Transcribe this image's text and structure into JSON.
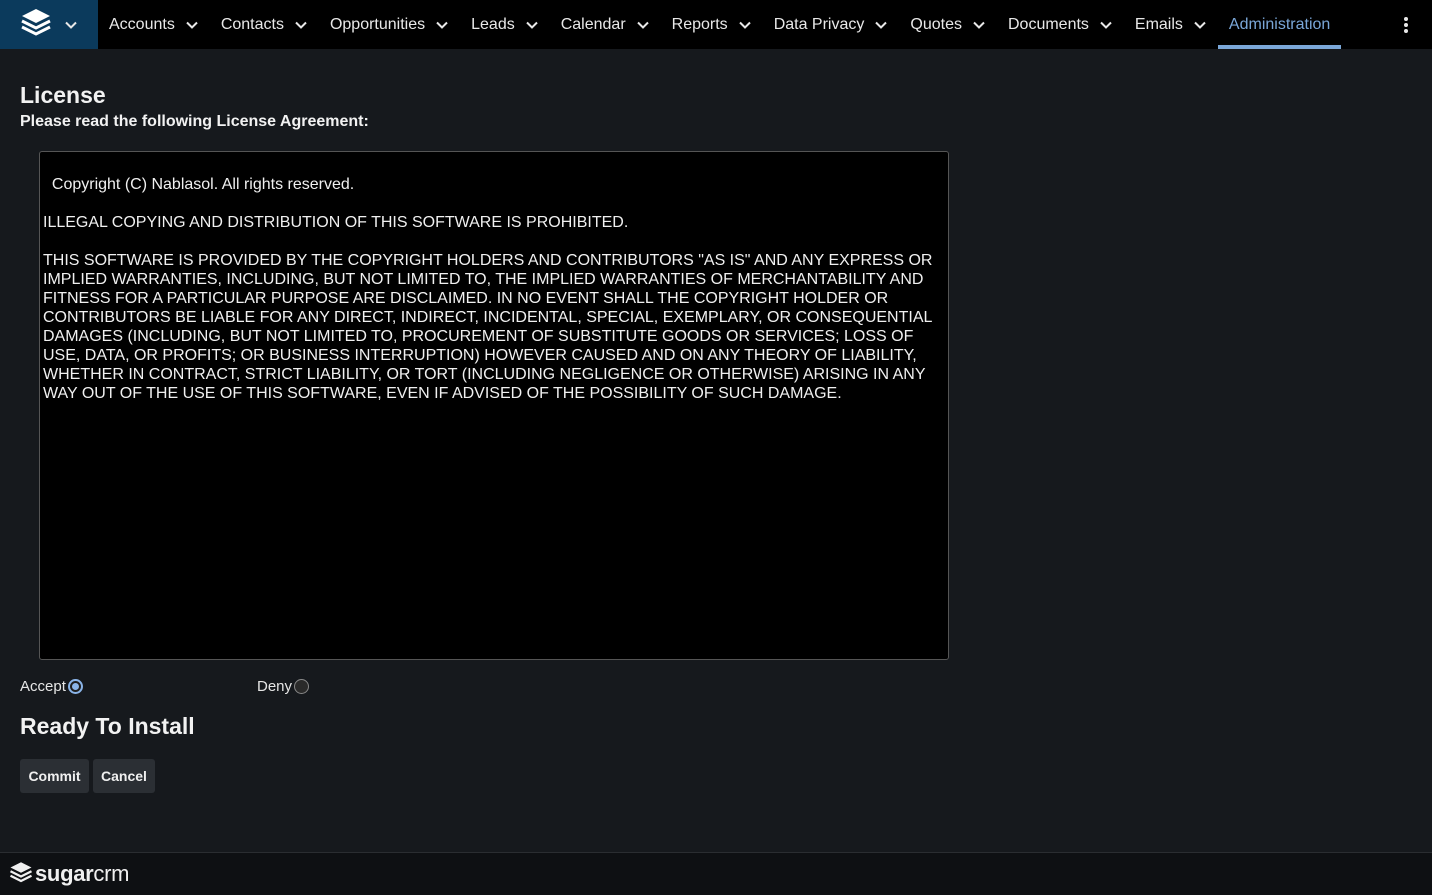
{
  "nav": {
    "items": [
      {
        "label": "Accounts"
      },
      {
        "label": "Contacts"
      },
      {
        "label": "Opportunities"
      },
      {
        "label": "Leads"
      },
      {
        "label": "Calendar"
      },
      {
        "label": "Reports"
      },
      {
        "label": "Data Privacy"
      },
      {
        "label": "Quotes"
      },
      {
        "label": "Documents"
      },
      {
        "label": "Emails"
      }
    ],
    "active": {
      "label": "Administration"
    },
    "accent_color": "#7aa7d8"
  },
  "page": {
    "title": "License",
    "subtitle": "Please read the following License Agreement:",
    "license_text": "Copyright (C) Nablasol. All rights reserved.\n\nILLEGAL COPYING AND DISTRIBUTION OF THIS SOFTWARE IS PROHIBITED.\n\nTHIS SOFTWARE IS PROVIDED BY THE COPYRIGHT HOLDERS AND CONTRIBUTORS \"AS IS\" AND ANY EXPRESS OR IMPLIED WARRANTIES, INCLUDING, BUT NOT LIMITED TO, THE IMPLIED WARRANTIES OF MERCHANTABILITY AND FITNESS FOR A PARTICULAR PURPOSE ARE DISCLAIMED. IN NO EVENT SHALL THE COPYRIGHT HOLDER OR CONTRIBUTORS BE LIABLE FOR ANY DIRECT, INDIRECT, INCIDENTAL, SPECIAL, EXEMPLARY, OR CONSEQUENTIAL DAMAGES (INCLUDING, BUT NOT LIMITED TO, PROCUREMENT OF SUBSTITUTE GOODS OR SERVICES; LOSS OF USE, DATA, OR PROFITS; OR BUSINESS INTERRUPTION) HOWEVER CAUSED AND ON ANY THEORY OF LIABILITY, WHETHER IN CONTRACT, STRICT LIABILITY, OR TORT (INCLUDING NEGLIGENCE OR OTHERWISE) ARISING IN ANY WAY OUT OF THE USE OF THIS SOFTWARE, EVEN IF ADVISED OF THE POSSIBILITY OF SUCH DAMAGE.",
    "accept_label": "Accept",
    "deny_label": "Deny",
    "selected": "accept",
    "ready_title": "Ready To Install",
    "commit_label": "Commit",
    "cancel_label": "Cancel"
  },
  "footer": {
    "brand_bold": "sugar",
    "brand_light": "crm"
  },
  "icons": {
    "logo": "layers-icon",
    "dropdown": "chevron-down-icon",
    "more": "kebab-menu-icon"
  }
}
